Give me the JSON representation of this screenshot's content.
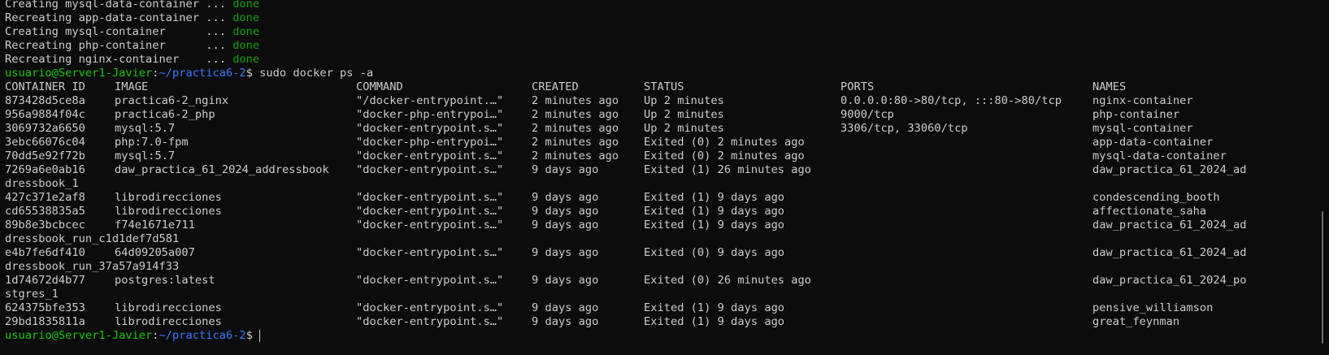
{
  "compose_output": [
    {
      "action": "Creating mysql-data-container ... ",
      "status": "done"
    },
    {
      "action": "Recreating app-data-container ... ",
      "status": "done"
    },
    {
      "action": "Creating mysql-container      ... ",
      "status": "done"
    },
    {
      "action": "Recreating php-container      ... ",
      "status": "done"
    },
    {
      "action": "Recreating nginx-container    ... ",
      "status": "done"
    }
  ],
  "prompt": {
    "user_host": "usuario@Server1-Javier",
    "separator": ":",
    "path": "~/practica6-2",
    "symbol": "$ "
  },
  "command": "sudo docker ps -a",
  "table": {
    "headers": {
      "id": "CONTAINER ID",
      "image": "IMAGE",
      "command": "COMMAND",
      "created": "CREATED",
      "status": "STATUS",
      "ports": "PORTS",
      "names": "NAMES"
    },
    "rows": [
      {
        "id": "873428d5ce8a",
        "image": "practica6-2_nginx",
        "command": "\"/docker-entrypoint.…\"",
        "created": "2 minutes ago",
        "status": "Up 2 minutes",
        "ports": "0.0.0.0:80->80/tcp, :::80->80/tcp",
        "names": "nginx-container"
      },
      {
        "id": "956a9884f04c",
        "image": "practica6-2_php",
        "command": "\"docker-php-entrypoi…\"",
        "created": "2 minutes ago",
        "status": "Up 2 minutes",
        "ports": "9000/tcp",
        "names": "php-container"
      },
      {
        "id": "3069732a6650",
        "image": "mysql:5.7",
        "command": "\"docker-entrypoint.s…\"",
        "created": "2 minutes ago",
        "status": "Up 2 minutes",
        "ports": "3306/tcp, 33060/tcp",
        "names": "mysql-container"
      },
      {
        "id": "3ebc66076c04",
        "image": "php:7.0-fpm",
        "command": "\"docker-php-entrypoi…\"",
        "created": "2 minutes ago",
        "status": "Exited (0) 2 minutes ago",
        "ports": "",
        "names": "app-data-container"
      },
      {
        "id": "70dd5e92f72b",
        "image": "mysql:5.7",
        "command": "\"docker-entrypoint.s…\"",
        "created": "2 minutes ago",
        "status": "Exited (0) 2 minutes ago",
        "ports": "",
        "names": "mysql-data-container"
      },
      {
        "id": "7269a6e0ab16",
        "image": "daw_practica_61_2024_addressbook",
        "command": "\"docker-entrypoint.s…\"",
        "created": "9 days ago",
        "status": "Exited (1) 26 minutes ago",
        "ports": "",
        "names": "daw_practica_61_2024_ad",
        "wrap": "dressbook_1"
      },
      {
        "id": "427c371e2af8",
        "image": "librodirecciones",
        "command": "\"docker-entrypoint.s…\"",
        "created": "9 days ago",
        "status": "Exited (1) 9 days ago",
        "ports": "",
        "names": "condescending_booth"
      },
      {
        "id": "cd65538835a5",
        "image": "librodirecciones",
        "command": "\"docker-entrypoint.s…\"",
        "created": "9 days ago",
        "status": "Exited (1) 9 days ago",
        "ports": "",
        "names": "affectionate_saha"
      },
      {
        "id": "89b8e3bcbcec",
        "image": "f74e1671e711",
        "command": "\"docker-entrypoint.s…\"",
        "created": "9 days ago",
        "status": "Exited (1) 9 days ago",
        "ports": "",
        "names": "daw_practica_61_2024_ad",
        "wrap": "dressbook_run_c1d1def7d581"
      },
      {
        "id": "e4b7fe6df410",
        "image": "64d09205a007",
        "command": "\"docker-entrypoint.s…\"",
        "created": "9 days ago",
        "status": "Exited (0) 9 days ago",
        "ports": "",
        "names": "daw_practica_61_2024_ad",
        "wrap": "dressbook_run_37a57a914f33"
      },
      {
        "id": "1d74672d4b77",
        "image": "postgres:latest",
        "command": "\"docker-entrypoint.s…\"",
        "created": "9 days ago",
        "status": "Exited (0) 26 minutes ago",
        "ports": "",
        "names": "daw_practica_61_2024_po",
        "wrap": "stgres_1"
      },
      {
        "id": "624375bfe353",
        "image": "librodirecciones",
        "command": "\"docker-entrypoint.s…\"",
        "created": "9 days ago",
        "status": "Exited (1) 9 days ago",
        "ports": "",
        "names": "pensive_williamson"
      },
      {
        "id": "29bd1835811a",
        "image": "librodirecciones",
        "command": "\"docker-entrypoint.s…\"",
        "created": "9 days ago",
        "status": "Exited (1) 9 days ago",
        "ports": "",
        "names": "great_feynman"
      }
    ]
  },
  "colors": {
    "background": "#0c0c0c",
    "text": "#cccccc",
    "done": "#13a10e",
    "user_host": "#16c60c",
    "path": "#3b78ff"
  }
}
